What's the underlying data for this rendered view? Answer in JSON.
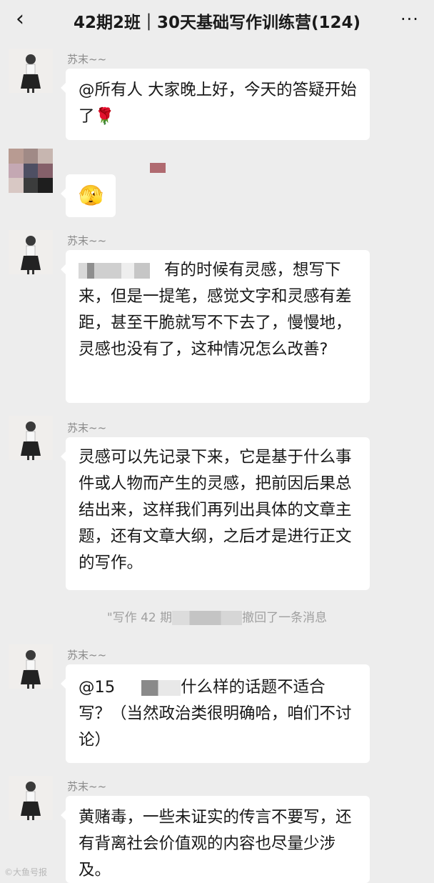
{
  "header": {
    "back_icon": "‹",
    "title": "42期2班｜30天基础写作训练营(124)",
    "more_icon": "···"
  },
  "messages": [
    {
      "nickname": "苏末~~",
      "text": "@所有人 大家晚上好，今天的答疑开始了🌹"
    },
    {
      "nickname": "",
      "text": "🫣"
    },
    {
      "nickname": "苏末~~",
      "text": "有的时候有灵感，想写下来，但是一提笔，感觉文字和灵感有差距，甚至干脆就写不下去了，慢慢地，灵感也没有了，这种情况怎么改善?"
    },
    {
      "nickname": "苏末~~",
      "text": "灵感可以先记录下来，它是基于什么事件或人物而产生的灵感，把前因后果总结出来，这样我们再列出具体的文章主题，还有文章大纲，之后才是进行正文的写作。"
    },
    {
      "nickname": "苏末~~",
      "text_prefix": "@15",
      "text": "什么样的话题不适合写？（当然政治类很明确哈，咱们不讨论）"
    },
    {
      "nickname": "苏末~~",
      "text": "黄赌毒，一些未证实的传言不要写，还有背离社会价值观的内容也尽量少涉及。"
    }
  ],
  "system": {
    "recall_prefix": "\"写作 42 期",
    "recall_suffix": "撤回了一条消息"
  },
  "watermark": "©大鱼号报"
}
